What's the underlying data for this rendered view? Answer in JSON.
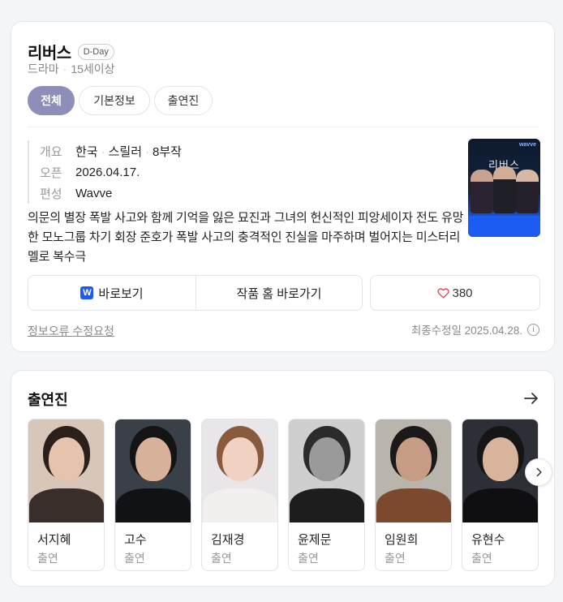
{
  "program": {
    "title": "리버스",
    "badge": "D-Day",
    "genre": "드라마",
    "rating": "15세이상"
  },
  "tabs": [
    {
      "label": "전체",
      "active": true
    },
    {
      "label": "기본정보",
      "active": false
    },
    {
      "label": "출연진",
      "active": false
    }
  ],
  "info": {
    "summary_key": "개요",
    "summary_parts": [
      "한국",
      "스릴러",
      "8부작"
    ],
    "open_key": "오픈",
    "open_val": "2026.04.17.",
    "channel_key": "편성",
    "channel_val": "Wavve"
  },
  "poster": {
    "title": "리버스",
    "brand": "wavve",
    "icon": "drama-poster-image"
  },
  "description": "의문의 별장 폭발 사고와 함께 기억을 잃은 묘진과 그녀의 헌신적인 피앙세이자 전도 유망한 모노그룹 차기 회장 준호가 폭발 사고의 충격적인 진실을 마주하며 벌어지는 미스터리 멜로 복수극",
  "actions": {
    "watch_label": "바로보기",
    "watch_icon": "wavve-icon",
    "watch_icon_text": "W",
    "home_label": "작품 홈 바로가기",
    "like_count": "380",
    "like_icon": "heart-icon"
  },
  "footer": {
    "report_label": "정보오류 수정요청",
    "modified_label": "최종수정일 2025.04.28.",
    "info_icon": "info-icon"
  },
  "cast_section": {
    "title": "출연진",
    "more_icon": "arrow-right-icon",
    "next_icon": "chevron-right-icon",
    "members": [
      {
        "name": "서지혜",
        "role": "출연",
        "bg": "#d8c6b8",
        "skin": "#e6c3ad",
        "hair": "#2a1f1b",
        "cloth": "#3a2e2a"
      },
      {
        "name": "고수",
        "role": "출연",
        "bg": "#3a4047",
        "skin": "#d7b19a",
        "hair": "#141414",
        "cloth": "#101216"
      },
      {
        "name": "김재경",
        "role": "출연",
        "bg": "#e9e6ea",
        "skin": "#f0d2c2",
        "hair": "#8a5a3c",
        "cloth": "#f2efee"
      },
      {
        "name": "윤제문",
        "role": "출연",
        "bg": "#cfcfcf",
        "skin": "#9a9a9a",
        "hair": "#2b2b2b",
        "cloth": "#1d1d1d"
      },
      {
        "name": "임원희",
        "role": "출연",
        "bg": "#b9b5ad",
        "skin": "#c69d84",
        "hair": "#1c1a18",
        "cloth": "#7b4a2e"
      },
      {
        "name": "유현수",
        "role": "출연",
        "bg": "#2c2f36",
        "skin": "#d9b49c",
        "hair": "#151515",
        "cloth": "#0f0f12"
      }
    ]
  }
}
